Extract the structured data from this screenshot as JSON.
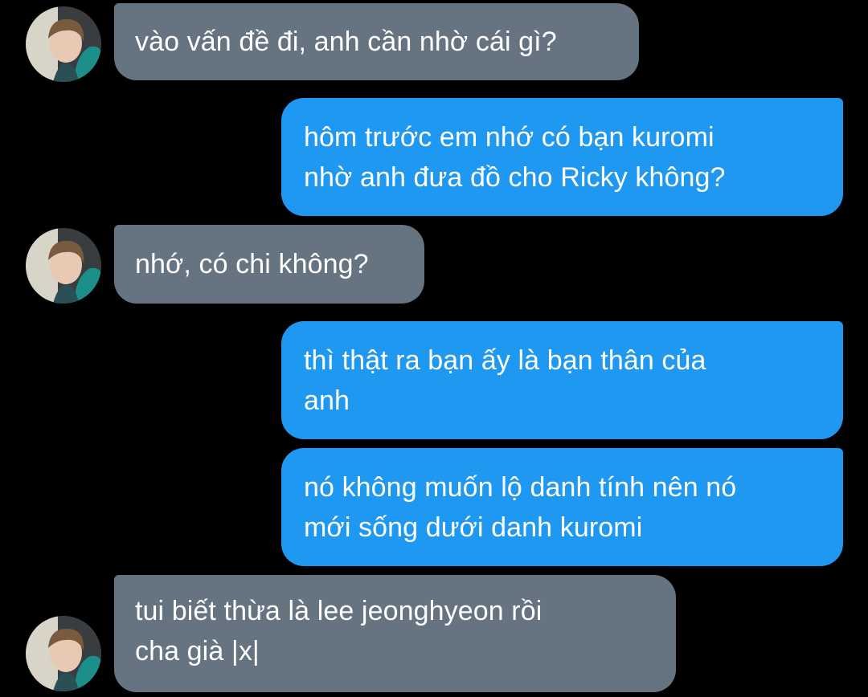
{
  "colors": {
    "background": "#000000",
    "incoming_bubble": "#667380",
    "outgoing_bubble": "#1e98f0",
    "text": "#ffffff"
  },
  "messages": [
    {
      "direction": "incoming",
      "avatar": "profile-photo",
      "text": "vào vấn đề đi, anh cần nhờ cái gì?"
    },
    {
      "direction": "outgoing",
      "text": "hôm trước em nhớ có bạn kuromi\nnhờ anh đưa đồ cho Ricky không?"
    },
    {
      "direction": "incoming",
      "avatar": "profile-photo",
      "text": "nhớ, có chi không?"
    },
    {
      "direction": "outgoing",
      "text": "thì thật ra bạn ấy là bạn thân của\nanh"
    },
    {
      "direction": "outgoing",
      "text": "nó không muốn lộ danh tính nên nó\nmới sống dưới danh kuromi"
    },
    {
      "direction": "incoming",
      "avatar": "profile-photo",
      "text": "tui biết thừa là lee jeonghyeon rồi\ncha già |x|"
    }
  ]
}
